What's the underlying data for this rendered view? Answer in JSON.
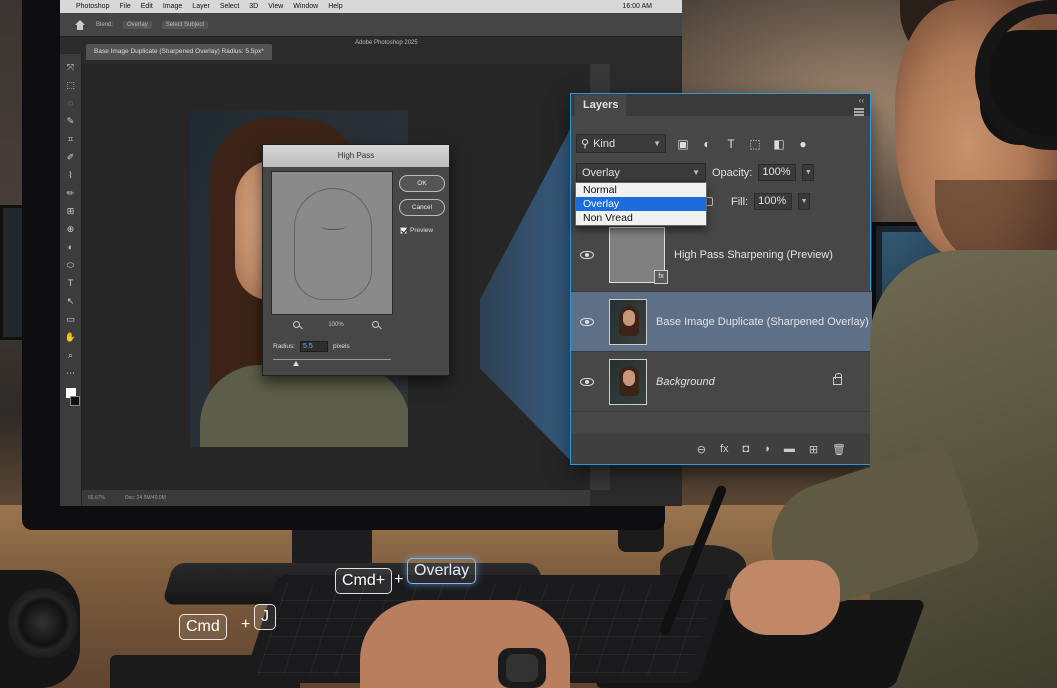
{
  "photoshop": {
    "menubar": {
      "items": [
        "Photoshop",
        "File",
        "Edit",
        "Image",
        "Layer",
        "Select",
        "3D",
        "View",
        "Window",
        "Help"
      ],
      "clock": "16:00 AM"
    },
    "optionsbar": {
      "blend_label": "Blend:",
      "blend_value": "Overlay",
      "mode_pill": "Select Subject"
    },
    "app_title": "Adobe Photoshop 2025",
    "doc_tab": "Base Image Duplicate (Sharpened Overlay) Radius: 5.5px*",
    "status": {
      "zoom": "66.67%",
      "doc": "Doc: 24.5M/49.0M"
    },
    "tools": [
      "⤧",
      "⬚",
      "◌",
      "✎",
      "⌗",
      "✐",
      "⌇",
      "✏",
      "⊞",
      "⊕",
      "◐",
      "⬭",
      "T",
      "↖",
      "▭",
      "✋",
      "⌕",
      "⋯"
    ]
  },
  "high_pass": {
    "title": "High Pass",
    "ok_label": "OK",
    "cancel_label": "Cancel",
    "preview_label": "Preview",
    "zoom": "100%",
    "radius_label": "Radius:",
    "radius_value": "5.5",
    "radius_unit": "pixels"
  },
  "layers_panel": {
    "tab_label": "Layers",
    "collapse_glyph": "‹‹",
    "kind_label": "Kind",
    "blend_mode": "Overlay",
    "blend_options": [
      "Normal",
      "Overlay",
      "Non Vread"
    ],
    "blend_selected_index": 1,
    "opacity_label": "Opacity:",
    "opacity_value": "100%",
    "fill_label": "Fill:",
    "fill_value": "100%",
    "layers": [
      {
        "name": "High Pass Sharpening (Preview)",
        "badge": "fx"
      },
      {
        "name": "Base Image Duplicate (Sharpened Overlay)"
      },
      {
        "name": "Background"
      }
    ],
    "footer_icons": [
      "link-icon",
      "fx-icon",
      "mask-icon",
      "adjustment-icon",
      "folder-icon",
      "new-layer-icon",
      "trash-icon"
    ],
    "footer_glyphs": [
      "⊖",
      "fx",
      "◘",
      "◑",
      "▬",
      "⊞",
      "🗑"
    ]
  },
  "shortcuts": {
    "combo1_key": "Cmd+",
    "combo1_plus": "+",
    "combo1_value": "Overlay",
    "combo2_key": "Cmd",
    "combo2_plus": "+",
    "combo2_value": "J"
  }
}
